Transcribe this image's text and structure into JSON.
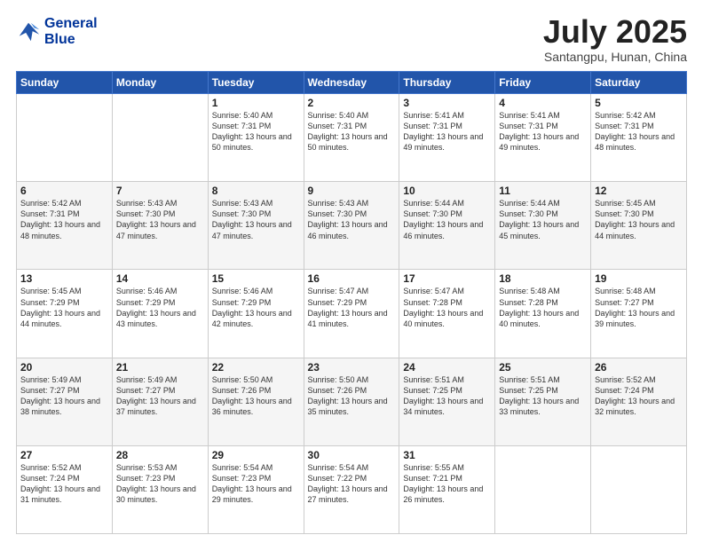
{
  "logo": {
    "line1": "General",
    "line2": "Blue"
  },
  "title": "July 2025",
  "location": "Santangpu, Hunan, China",
  "days_of_week": [
    "Sunday",
    "Monday",
    "Tuesday",
    "Wednesday",
    "Thursday",
    "Friday",
    "Saturday"
  ],
  "weeks": [
    [
      {
        "day": "",
        "info": ""
      },
      {
        "day": "",
        "info": ""
      },
      {
        "day": "1",
        "info": "Sunrise: 5:40 AM\nSunset: 7:31 PM\nDaylight: 13 hours and 50 minutes."
      },
      {
        "day": "2",
        "info": "Sunrise: 5:40 AM\nSunset: 7:31 PM\nDaylight: 13 hours and 50 minutes."
      },
      {
        "day": "3",
        "info": "Sunrise: 5:41 AM\nSunset: 7:31 PM\nDaylight: 13 hours and 49 minutes."
      },
      {
        "day": "4",
        "info": "Sunrise: 5:41 AM\nSunset: 7:31 PM\nDaylight: 13 hours and 49 minutes."
      },
      {
        "day": "5",
        "info": "Sunrise: 5:42 AM\nSunset: 7:31 PM\nDaylight: 13 hours and 48 minutes."
      }
    ],
    [
      {
        "day": "6",
        "info": "Sunrise: 5:42 AM\nSunset: 7:31 PM\nDaylight: 13 hours and 48 minutes."
      },
      {
        "day": "7",
        "info": "Sunrise: 5:43 AM\nSunset: 7:30 PM\nDaylight: 13 hours and 47 minutes."
      },
      {
        "day": "8",
        "info": "Sunrise: 5:43 AM\nSunset: 7:30 PM\nDaylight: 13 hours and 47 minutes."
      },
      {
        "day": "9",
        "info": "Sunrise: 5:43 AM\nSunset: 7:30 PM\nDaylight: 13 hours and 46 minutes."
      },
      {
        "day": "10",
        "info": "Sunrise: 5:44 AM\nSunset: 7:30 PM\nDaylight: 13 hours and 46 minutes."
      },
      {
        "day": "11",
        "info": "Sunrise: 5:44 AM\nSunset: 7:30 PM\nDaylight: 13 hours and 45 minutes."
      },
      {
        "day": "12",
        "info": "Sunrise: 5:45 AM\nSunset: 7:30 PM\nDaylight: 13 hours and 44 minutes."
      }
    ],
    [
      {
        "day": "13",
        "info": "Sunrise: 5:45 AM\nSunset: 7:29 PM\nDaylight: 13 hours and 44 minutes."
      },
      {
        "day": "14",
        "info": "Sunrise: 5:46 AM\nSunset: 7:29 PM\nDaylight: 13 hours and 43 minutes."
      },
      {
        "day": "15",
        "info": "Sunrise: 5:46 AM\nSunset: 7:29 PM\nDaylight: 13 hours and 42 minutes."
      },
      {
        "day": "16",
        "info": "Sunrise: 5:47 AM\nSunset: 7:29 PM\nDaylight: 13 hours and 41 minutes."
      },
      {
        "day": "17",
        "info": "Sunrise: 5:47 AM\nSunset: 7:28 PM\nDaylight: 13 hours and 40 minutes."
      },
      {
        "day": "18",
        "info": "Sunrise: 5:48 AM\nSunset: 7:28 PM\nDaylight: 13 hours and 40 minutes."
      },
      {
        "day": "19",
        "info": "Sunrise: 5:48 AM\nSunset: 7:27 PM\nDaylight: 13 hours and 39 minutes."
      }
    ],
    [
      {
        "day": "20",
        "info": "Sunrise: 5:49 AM\nSunset: 7:27 PM\nDaylight: 13 hours and 38 minutes."
      },
      {
        "day": "21",
        "info": "Sunrise: 5:49 AM\nSunset: 7:27 PM\nDaylight: 13 hours and 37 minutes."
      },
      {
        "day": "22",
        "info": "Sunrise: 5:50 AM\nSunset: 7:26 PM\nDaylight: 13 hours and 36 minutes."
      },
      {
        "day": "23",
        "info": "Sunrise: 5:50 AM\nSunset: 7:26 PM\nDaylight: 13 hours and 35 minutes."
      },
      {
        "day": "24",
        "info": "Sunrise: 5:51 AM\nSunset: 7:25 PM\nDaylight: 13 hours and 34 minutes."
      },
      {
        "day": "25",
        "info": "Sunrise: 5:51 AM\nSunset: 7:25 PM\nDaylight: 13 hours and 33 minutes."
      },
      {
        "day": "26",
        "info": "Sunrise: 5:52 AM\nSunset: 7:24 PM\nDaylight: 13 hours and 32 minutes."
      }
    ],
    [
      {
        "day": "27",
        "info": "Sunrise: 5:52 AM\nSunset: 7:24 PM\nDaylight: 13 hours and 31 minutes."
      },
      {
        "day": "28",
        "info": "Sunrise: 5:53 AM\nSunset: 7:23 PM\nDaylight: 13 hours and 30 minutes."
      },
      {
        "day": "29",
        "info": "Sunrise: 5:54 AM\nSunset: 7:23 PM\nDaylight: 13 hours and 29 minutes."
      },
      {
        "day": "30",
        "info": "Sunrise: 5:54 AM\nSunset: 7:22 PM\nDaylight: 13 hours and 27 minutes."
      },
      {
        "day": "31",
        "info": "Sunrise: 5:55 AM\nSunset: 7:21 PM\nDaylight: 13 hours and 26 minutes."
      },
      {
        "day": "",
        "info": ""
      },
      {
        "day": "",
        "info": ""
      }
    ]
  ]
}
